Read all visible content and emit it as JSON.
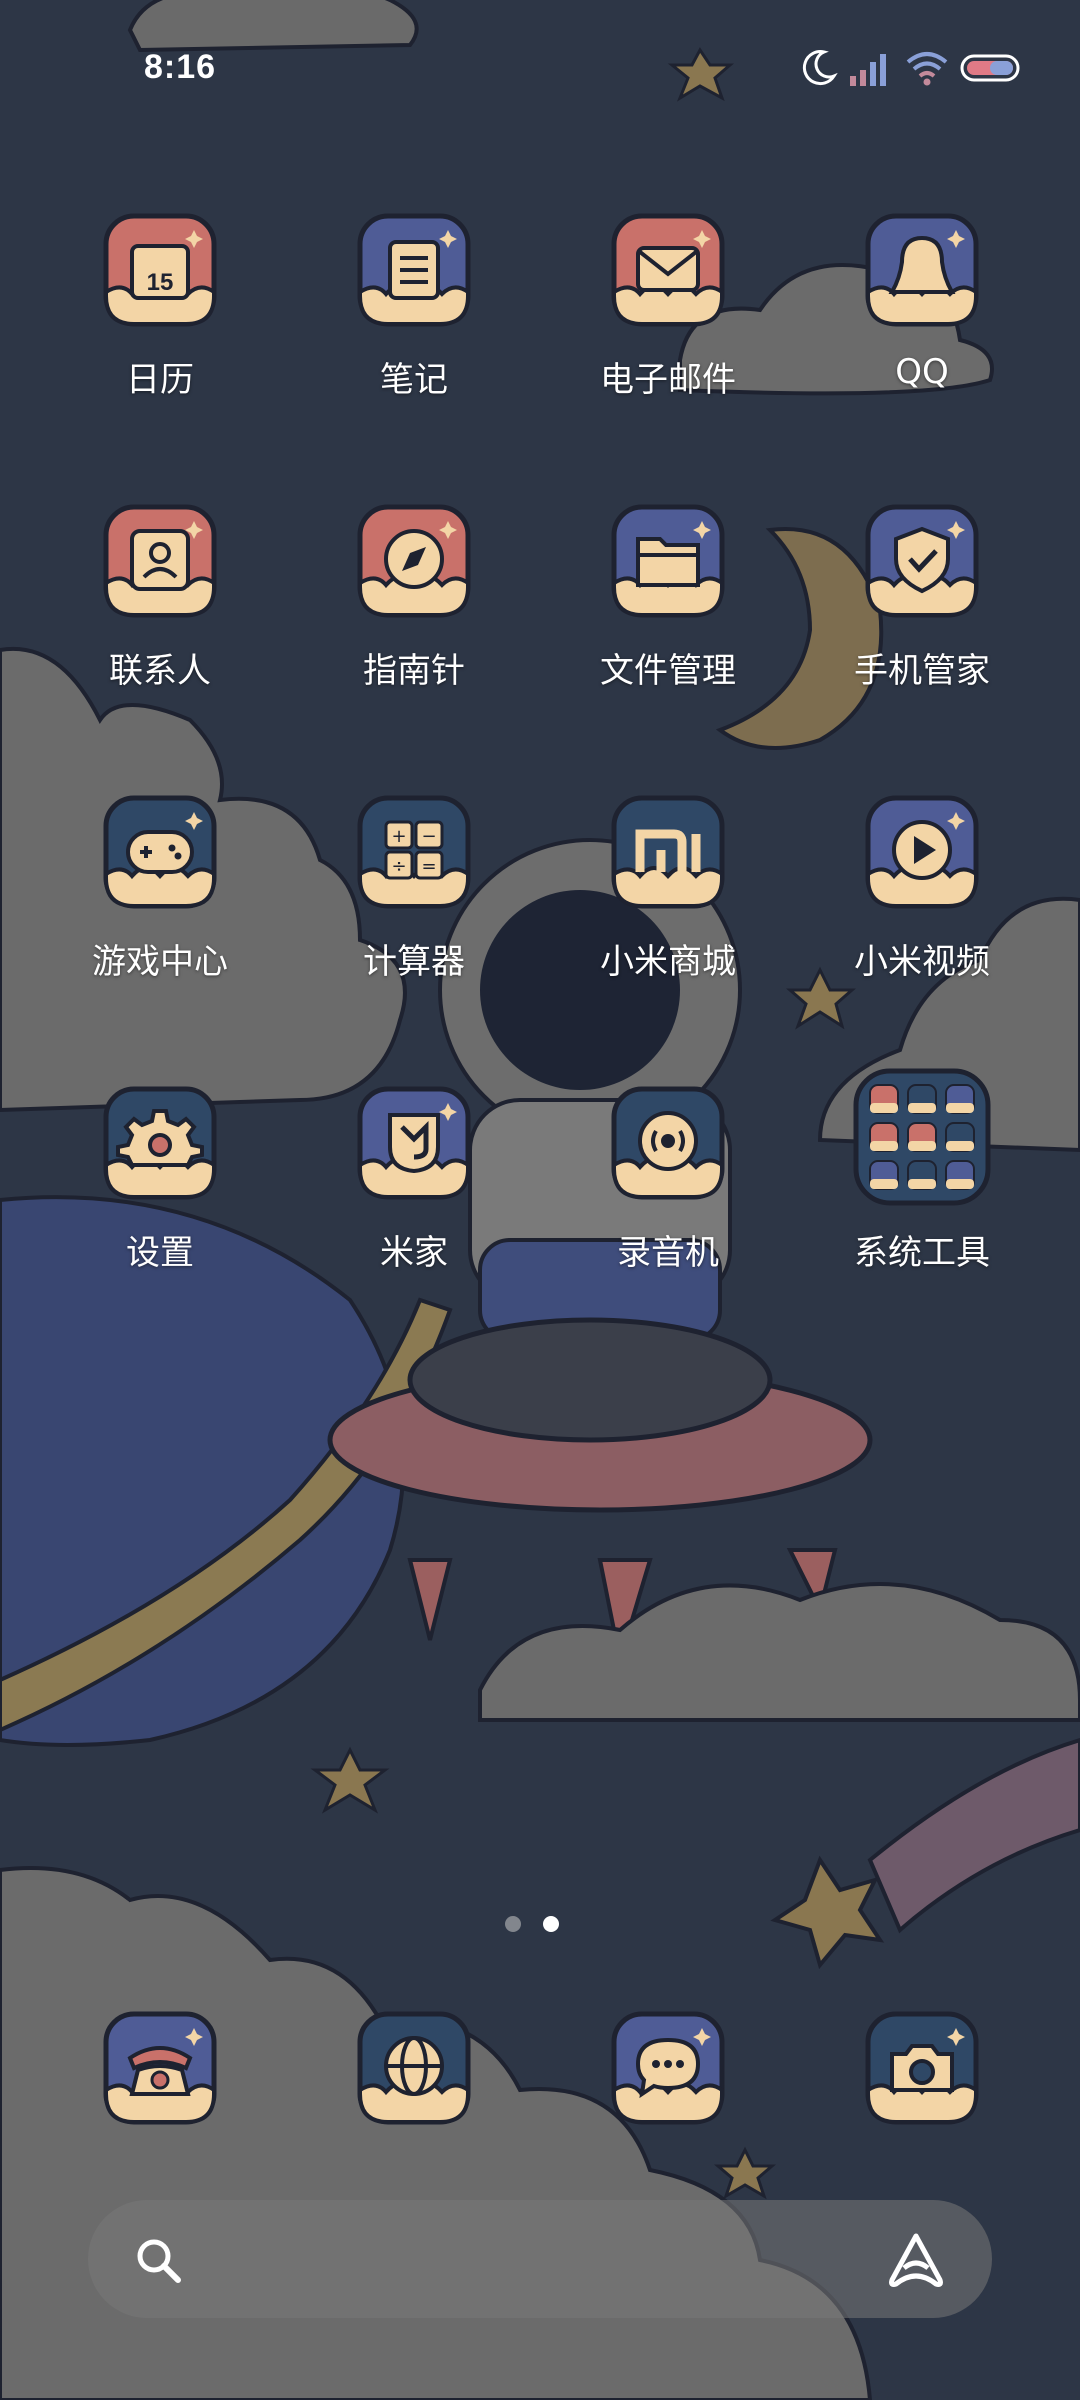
{
  "status_bar": {
    "time": "8:16",
    "icons": [
      "moon-icon",
      "signal-icon",
      "wifi-icon",
      "battery-icon"
    ]
  },
  "apps": [
    {
      "label": "日历",
      "icon": "calendar-icon",
      "name": "app-calendar"
    },
    {
      "label": "笔记",
      "icon": "notes-icon",
      "name": "app-notes"
    },
    {
      "label": "电子邮件",
      "icon": "mail-icon",
      "name": "app-email"
    },
    {
      "label": "QQ",
      "icon": "qq-penguin-icon",
      "name": "app-qq"
    },
    {
      "label": "联系人",
      "icon": "contacts-icon",
      "name": "app-contacts"
    },
    {
      "label": "指南针",
      "icon": "compass-icon",
      "name": "app-compass"
    },
    {
      "label": "文件管理",
      "icon": "folder-icon",
      "name": "app-file-manager"
    },
    {
      "label": "手机管家",
      "icon": "shield-check-icon",
      "name": "app-security"
    },
    {
      "label": "游戏中心",
      "icon": "gamepad-icon",
      "name": "app-game-center"
    },
    {
      "label": "计算器",
      "icon": "calculator-icon",
      "name": "app-calculator"
    },
    {
      "label": "小米商城",
      "icon": "mi-logo-icon",
      "name": "app-mi-store"
    },
    {
      "label": "小米视频",
      "icon": "play-icon",
      "name": "app-mi-video"
    },
    {
      "label": "设置",
      "icon": "gear-icon",
      "name": "app-settings"
    },
    {
      "label": "米家",
      "icon": "mijia-icon",
      "name": "app-mijia"
    },
    {
      "label": "录音机",
      "icon": "recorder-icon",
      "name": "app-recorder"
    },
    {
      "label": "系统工具",
      "icon": "folder-grid-icon",
      "name": "folder-system-tools"
    }
  ],
  "dock": [
    {
      "icon": "phone-icon",
      "name": "dock-phone"
    },
    {
      "icon": "browser-globe-icon",
      "name": "dock-browser"
    },
    {
      "icon": "message-bubble-icon",
      "name": "dock-messages"
    },
    {
      "icon": "camera-icon",
      "name": "dock-camera"
    }
  ],
  "page_indicator": {
    "pages": 2,
    "current": 2
  },
  "search_bar": {
    "left_icon": "search-icon",
    "right_icon": "xiaoai-assistant-icon"
  },
  "colors": {
    "red_tile": "#c9716a",
    "blue_tile": "#4f5c96",
    "navy_tile": "#2f4866",
    "cream": "#f3d5a6",
    "outline": "#1e2230",
    "background": "#2d3646"
  }
}
